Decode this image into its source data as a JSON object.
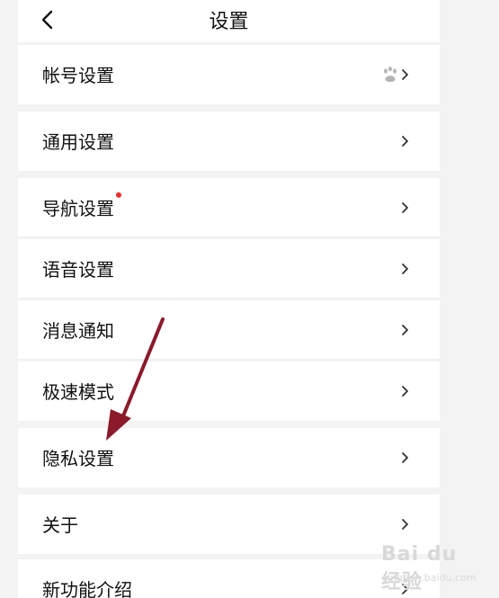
{
  "header": {
    "title": "设置"
  },
  "settings": {
    "items": [
      {
        "label": "帐号设置",
        "badge": "paw-icon"
      },
      {
        "label": "通用设置"
      },
      {
        "label": "导航设置",
        "dot": "#ee2b2b"
      },
      {
        "label": "语音设置"
      },
      {
        "label": "消息通知"
      },
      {
        "label": "极速模式"
      },
      {
        "label": "隐私设置"
      },
      {
        "label": "关于"
      },
      {
        "label": "新功能介绍"
      }
    ]
  },
  "annotation": {
    "arrow_color": "#8b1a2b"
  },
  "watermark": {
    "main": "Bai du 经验",
    "sub": "jingyan.baidu.com"
  }
}
